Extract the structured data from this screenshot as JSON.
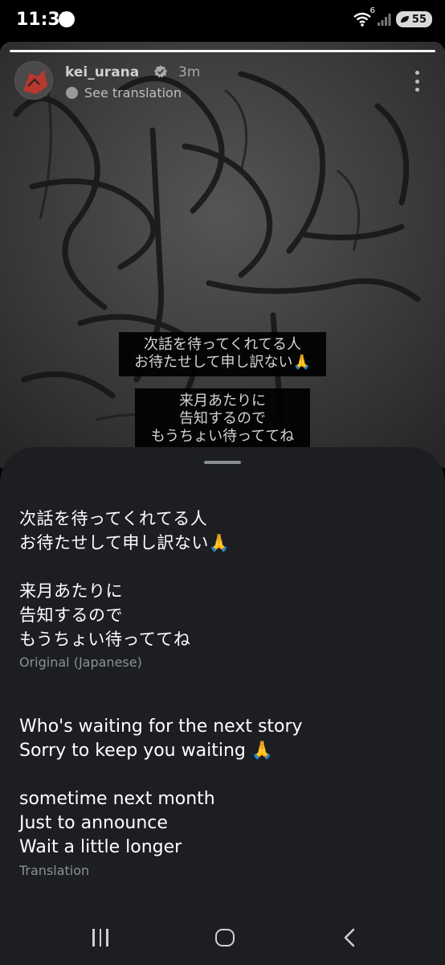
{
  "status_bar": {
    "time": "11:31",
    "wifi_generation": "6",
    "battery_level": "55",
    "icons": [
      "wifi-icon",
      "signal-icon",
      "battery-icon"
    ]
  },
  "story": {
    "username": "kei_urana",
    "time_ago": "3m",
    "see_translation": "See translation",
    "progress": 1.0,
    "caption_1": [
      "次話を待ってくれてる人",
      "お待たせして申し訳ない🙏"
    ],
    "caption_2": [
      "来月あたりに",
      "告知するので",
      "もうちょい待っててね"
    ],
    "icons": [
      "verified-icon",
      "more-options-icon"
    ]
  },
  "translation_sheet": {
    "original_lines": [
      "次話を待ってくれてる人",
      "お待たせして申し訳ない🙏",
      "",
      "来月あたりに",
      "告知するので",
      "もうちょい待っててね"
    ],
    "original_label": "Original (Japanese)",
    "translation_lines": [
      "Who's waiting for the next story",
      "Sorry to keep you waiting 🙏",
      "",
      "sometime next month",
      "Just to announce",
      "Wait a little longer"
    ],
    "translation_label": "Translation"
  },
  "nav_bar": {
    "icons": [
      "recents-icon",
      "home-icon",
      "back-icon"
    ]
  },
  "colors": {
    "sheet_background": "#1c1e21",
    "secondary_text": "#8d9094",
    "status_background": "#000000"
  }
}
